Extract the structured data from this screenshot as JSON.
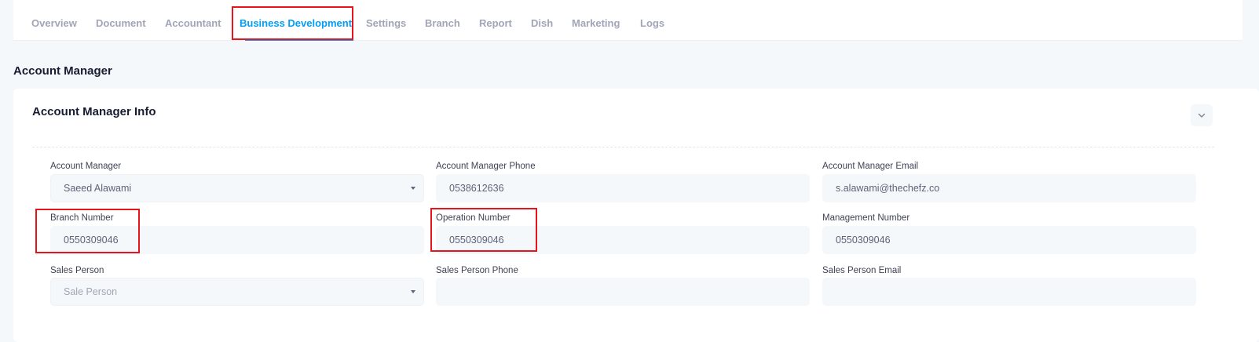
{
  "tabs": [
    {
      "label": "Overview",
      "active": false
    },
    {
      "label": "Document",
      "active": false
    },
    {
      "label": "Accountant",
      "active": false
    },
    {
      "label": "Business Development",
      "active": true
    },
    {
      "label": "Settings",
      "active": false
    },
    {
      "label": "Branch",
      "active": false
    },
    {
      "label": "Report",
      "active": false
    },
    {
      "label": "Dish",
      "active": false
    },
    {
      "label": "Marketing",
      "active": false
    },
    {
      "label": "Logs",
      "active": false
    }
  ],
  "section": {
    "title": "Account Manager"
  },
  "card": {
    "title": "Account Manager Info",
    "collapse_icon": "chevron-down-icon"
  },
  "fields": {
    "account_manager": {
      "label": "Account Manager",
      "value": "Saeed Alawami"
    },
    "account_manager_phone": {
      "label": "Account Manager Phone",
      "value": "0538612636"
    },
    "account_manager_email": {
      "label": "Account Manager Email",
      "value": "s.alawami@thechefz.co"
    },
    "branch_number": {
      "label": "Branch Number",
      "value": "0550309046"
    },
    "operation_number": {
      "label": "Operation Number",
      "value": "0550309046"
    },
    "management_number": {
      "label": "Management Number",
      "value": "0550309046"
    },
    "sales_person": {
      "label": "Sales Person",
      "placeholder": "Sale Person"
    },
    "sales_person_phone": {
      "label": "Sales Person Phone",
      "value": ""
    },
    "sales_person_email": {
      "label": "Sales Person Email",
      "value": ""
    }
  },
  "colors": {
    "accent": "#009ef7",
    "annotation": "#e8141b",
    "background": "#f5f8fa"
  }
}
